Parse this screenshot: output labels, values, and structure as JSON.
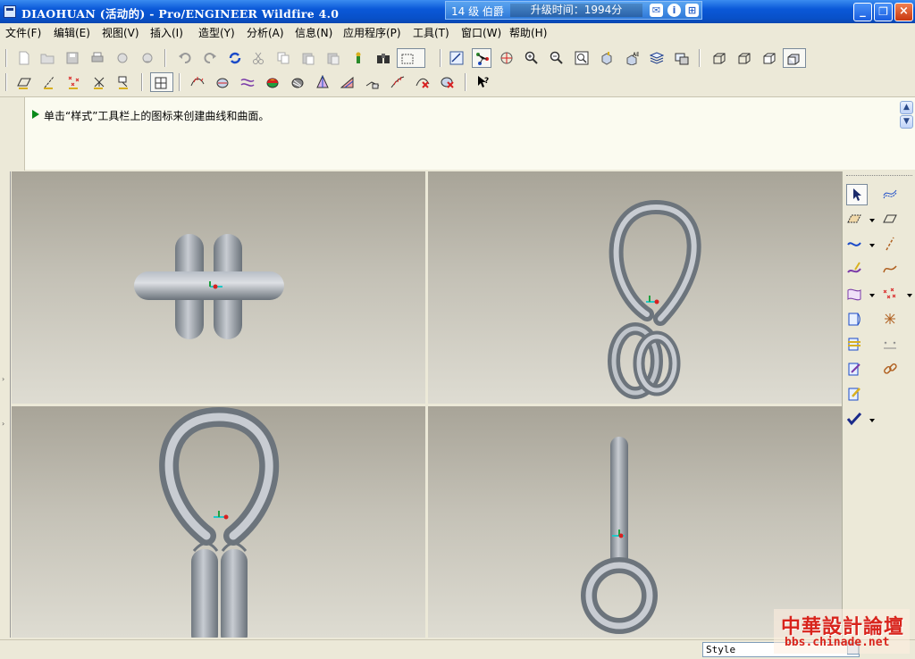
{
  "window": {
    "title": "DIAOHUAN (活动的) - Pro/ENGINEER Wildfire 4.0",
    "rank_level": "14 级 伯爵",
    "rank_upgrade": "升级时间：1994分",
    "minimize_label": "_",
    "maximize_label": "❐",
    "close_label": "×"
  },
  "menu": [
    "文件(F)",
    "编辑(E)",
    "视图(V)",
    "插入(I)",
    "造型(Y)",
    "分析(A)",
    "信息(N)",
    "应用程序(P)",
    "工具(T)",
    "窗口(W)",
    "帮助(H)"
  ],
  "message": {
    "text": "单击“样式”工具栏上的图标来创建曲线和曲面。"
  },
  "status": {
    "style_value": "Style"
  },
  "watermark": {
    "text": "中華設計論壇",
    "url": "bbs.chinade.net"
  },
  "colors": {
    "titlebar": "#0a58d8",
    "model": "#9aa0a8",
    "viewport_top": "#a8a498",
    "viewport_bottom": "#dedcd2",
    "watermark": "#d8241c"
  }
}
